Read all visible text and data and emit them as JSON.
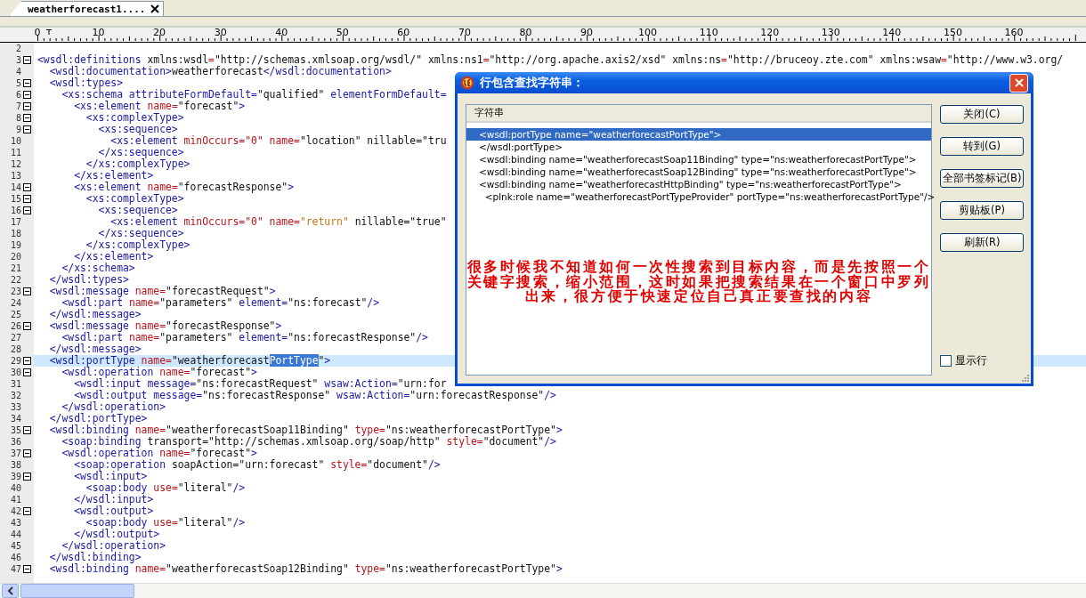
{
  "tabs": [
    {
      "label": "weatherforecast1....",
      "selected": true
    }
  ],
  "ruler": {
    "labels": [
      "0",
      "10",
      "20",
      "30",
      "40",
      "50",
      "60",
      "70",
      "80",
      "90",
      "100",
      "110",
      "120",
      "130",
      "140",
      "150",
      "160"
    ]
  },
  "editor": {
    "lines": [
      {
        "number": "2",
        "fold": false,
        "current": false
      },
      {
        "number": "3",
        "fold": true,
        "current": false,
        "segments": [
          {
            "kind": "tag",
            "text": "<wsdl:definitions "
          },
          {
            "kind": "plain",
            "text": "xmlns:wsdl"
          },
          {
            "kind": "key",
            "text": "="
          },
          {
            "kind": "plain",
            "text": "\"http://schemas.xmlsoap.org/wsdl/\" xmlns:ns1"
          },
          {
            "kind": "key",
            "text": "="
          },
          {
            "kind": "plain",
            "text": "\"http://org.apache.axis2/xsd\" xmlns:ns"
          },
          {
            "kind": "key",
            "text": "="
          },
          {
            "kind": "plain",
            "text": "\"http://bruceoy.zte.com\" xmlns:wsaw"
          },
          {
            "kind": "key",
            "text": "="
          },
          {
            "kind": "plain",
            "text": "\"http://www.w3.org/"
          }
        ]
      },
      {
        "number": "4",
        "fold": false,
        "current": false,
        "segments": [
          {
            "kind": "tag",
            "text": "  <wsdl:documentation>"
          },
          {
            "kind": "plain",
            "text": "weatherforecast"
          },
          {
            "kind": "tag",
            "text": "</wsdl:documentation>"
          }
        ]
      },
      {
        "number": "5",
        "fold": true,
        "current": false,
        "segments": [
          {
            "kind": "tag",
            "text": "  <wsdl:types>"
          }
        ]
      },
      {
        "number": "6",
        "fold": true,
        "current": false,
        "segments": [
          {
            "kind": "tag",
            "text": "    <xs:schema attributeFormDefault="
          },
          {
            "kind": "plain",
            "text": "\"qualified\" "
          },
          {
            "kind": "tag",
            "text": "elementFormDefault="
          }
        ]
      },
      {
        "number": "7",
        "fold": true,
        "current": false,
        "segments": [
          {
            "kind": "tag",
            "text": "      <xs:element "
          },
          {
            "kind": "key",
            "text": "name="
          },
          {
            "kind": "plain",
            "text": "\"forecast\""
          },
          {
            "kind": "tag",
            "text": ">"
          }
        ]
      },
      {
        "number": "8",
        "fold": true,
        "current": false,
        "segments": [
          {
            "kind": "tag",
            "text": "        <xs:complexType>"
          }
        ]
      },
      {
        "number": "9",
        "fold": true,
        "current": false,
        "segments": [
          {
            "kind": "tag",
            "text": "          <xs:sequence>"
          }
        ]
      },
      {
        "number": "10",
        "fold": false,
        "current": false,
        "segments": [
          {
            "kind": "tag",
            "text": "            <xs:element "
          },
          {
            "kind": "key",
            "text": "minOccurs=\"0\" name="
          },
          {
            "kind": "plain",
            "text": "\"location\" nillable=\"tru"
          }
        ]
      },
      {
        "number": "11",
        "fold": false,
        "current": false,
        "segments": [
          {
            "kind": "tag",
            "text": "          </xs:sequence>"
          }
        ]
      },
      {
        "number": "12",
        "fold": false,
        "current": false,
        "segments": [
          {
            "kind": "tag",
            "text": "        </xs:complexType>"
          }
        ]
      },
      {
        "number": "13",
        "fold": false,
        "current": false,
        "segments": [
          {
            "kind": "tag",
            "text": "      </xs:element>"
          }
        ]
      },
      {
        "number": "14",
        "fold": true,
        "current": false,
        "segments": [
          {
            "kind": "tag",
            "text": "      <xs:element "
          },
          {
            "kind": "key",
            "text": "name="
          },
          {
            "kind": "plain",
            "text": "\"forecastResponse\""
          },
          {
            "kind": "tag",
            "text": ">"
          }
        ]
      },
      {
        "number": "15",
        "fold": true,
        "current": false,
        "segments": [
          {
            "kind": "tag",
            "text": "        <xs:complexType>"
          }
        ]
      },
      {
        "number": "16",
        "fold": true,
        "current": false,
        "segments": [
          {
            "kind": "tag",
            "text": "          <xs:sequence>"
          }
        ]
      },
      {
        "number": "17",
        "fold": false,
        "current": false,
        "segments": [
          {
            "kind": "tag",
            "text": "            <xs:element "
          },
          {
            "kind": "key",
            "text": "minOccurs=\"0\" name="
          },
          {
            "kind": "value",
            "text": "\"return\""
          },
          {
            "kind": "plain",
            "text": " nillable=\"true\""
          }
        ]
      },
      {
        "number": "18",
        "fold": false,
        "current": false,
        "segments": [
          {
            "kind": "tag",
            "text": "          </xs:sequence>"
          }
        ]
      },
      {
        "number": "19",
        "fold": false,
        "current": false,
        "segments": [
          {
            "kind": "tag",
            "text": "        </xs:complexType>"
          }
        ]
      },
      {
        "number": "20",
        "fold": false,
        "current": false,
        "segments": [
          {
            "kind": "tag",
            "text": "      </xs:element>"
          }
        ]
      },
      {
        "number": "21",
        "fold": false,
        "current": false,
        "segments": [
          {
            "kind": "tag",
            "text": "    </xs:schema>"
          }
        ]
      },
      {
        "number": "22",
        "fold": false,
        "current": false,
        "segments": [
          {
            "kind": "tag",
            "text": "  </wsdl:types>"
          }
        ]
      },
      {
        "number": "23",
        "fold": true,
        "current": false,
        "segments": [
          {
            "kind": "tag",
            "text": "  <wsdl:message "
          },
          {
            "kind": "key",
            "text": "name="
          },
          {
            "kind": "plain",
            "text": "\"forecastRequest\""
          },
          {
            "kind": "tag",
            "text": ">"
          }
        ]
      },
      {
        "number": "24",
        "fold": false,
        "current": false,
        "segments": [
          {
            "kind": "tag",
            "text": "    <wsdl:part "
          },
          {
            "kind": "key",
            "text": "name="
          },
          {
            "kind": "plain",
            "text": "\"parameters\" "
          },
          {
            "kind": "tag",
            "text": "element="
          },
          {
            "kind": "plain",
            "text": "\"ns:forecast\""
          },
          {
            "kind": "tag",
            "text": "/>"
          }
        ]
      },
      {
        "number": "25",
        "fold": false,
        "current": false,
        "segments": [
          {
            "kind": "tag",
            "text": "  </wsdl:message>"
          }
        ]
      },
      {
        "number": "26",
        "fold": true,
        "current": false,
        "segments": [
          {
            "kind": "tag",
            "text": "  <wsdl:message "
          },
          {
            "kind": "key",
            "text": "name="
          },
          {
            "kind": "plain",
            "text": "\"forecastResponse\""
          },
          {
            "kind": "tag",
            "text": ">"
          }
        ]
      },
      {
        "number": "27",
        "fold": false,
        "current": false,
        "segments": [
          {
            "kind": "tag",
            "text": "    <wsdl:part "
          },
          {
            "kind": "key",
            "text": "name="
          },
          {
            "kind": "plain",
            "text": "\"parameters\" "
          },
          {
            "kind": "tag",
            "text": "element="
          },
          {
            "kind": "plain",
            "text": "\"ns:forecastResponse\""
          },
          {
            "kind": "tag",
            "text": "/>"
          }
        ]
      },
      {
        "number": "28",
        "fold": false,
        "current": false,
        "segments": [
          {
            "kind": "tag",
            "text": "  </wsdl:message>"
          }
        ]
      },
      {
        "number": "29",
        "fold": true,
        "current": true,
        "segments": [
          {
            "kind": "tag",
            "text": "  <wsdl:portType "
          },
          {
            "kind": "key",
            "text": "name="
          },
          {
            "kind": "plain",
            "text": "\"weatherforecast"
          },
          {
            "kind": "selected",
            "text": "PortType"
          },
          {
            "kind": "plain",
            "text": "\""
          },
          {
            "kind": "tag",
            "text": ">"
          }
        ]
      },
      {
        "number": "30",
        "fold": true,
        "current": false,
        "segments": [
          {
            "kind": "tag",
            "text": "    <wsdl:operation "
          },
          {
            "kind": "key",
            "text": "name="
          },
          {
            "kind": "plain",
            "text": "\"forecast\""
          },
          {
            "kind": "tag",
            "text": ">"
          }
        ]
      },
      {
        "number": "31",
        "fold": false,
        "current": false,
        "segments": [
          {
            "kind": "tag",
            "text": "      <wsdl:input message="
          },
          {
            "kind": "plain",
            "text": "\"ns:forecastRequest\" "
          },
          {
            "kind": "tag",
            "text": "wsaw:Action="
          },
          {
            "kind": "plain",
            "text": "\"urn:for"
          }
        ]
      },
      {
        "number": "32",
        "fold": false,
        "current": false,
        "segments": [
          {
            "kind": "tag",
            "text": "      <wsdl:output message="
          },
          {
            "kind": "plain",
            "text": "\"ns:forecastResponse\" "
          },
          {
            "kind": "tag",
            "text": "wsaw:Action="
          },
          {
            "kind": "plain",
            "text": "\"urn:forecastResponse\""
          },
          {
            "kind": "tag",
            "text": "/>"
          }
        ]
      },
      {
        "number": "33",
        "fold": false,
        "current": false,
        "segments": [
          {
            "kind": "tag",
            "text": "    </wsdl:operation>"
          }
        ]
      },
      {
        "number": "34",
        "fold": false,
        "current": false,
        "segments": [
          {
            "kind": "tag",
            "text": "  </wsdl:portType>"
          }
        ]
      },
      {
        "number": "35",
        "fold": true,
        "current": false,
        "segments": [
          {
            "kind": "tag",
            "text": "  <wsdl:binding "
          },
          {
            "kind": "key",
            "text": "name="
          },
          {
            "kind": "plain",
            "text": "\"weatherforecastSoap11Binding\" "
          },
          {
            "kind": "key",
            "text": "type="
          },
          {
            "kind": "plain",
            "text": "\"ns:weatherforecastPortType\""
          },
          {
            "kind": "tag",
            "text": ">"
          }
        ]
      },
      {
        "number": "36",
        "fold": false,
        "current": false,
        "segments": [
          {
            "kind": "tag",
            "text": "    <soap:binding "
          },
          {
            "kind": "plain",
            "text": "transport=\"http://schemas.xmlsoap.org/soap/http\" "
          },
          {
            "kind": "key",
            "text": "style="
          },
          {
            "kind": "plain",
            "text": "\"document\""
          },
          {
            "kind": "tag",
            "text": "/>"
          }
        ]
      },
      {
        "number": "37",
        "fold": true,
        "current": false,
        "segments": [
          {
            "kind": "tag",
            "text": "    <wsdl:operation "
          },
          {
            "kind": "key",
            "text": "name="
          },
          {
            "kind": "plain",
            "text": "\"forecast\""
          },
          {
            "kind": "tag",
            "text": ">"
          }
        ]
      },
      {
        "number": "38",
        "fold": false,
        "current": false,
        "segments": [
          {
            "kind": "tag",
            "text": "      <soap:operation "
          },
          {
            "kind": "plain",
            "text": "soapAction=\"urn:forecast\" "
          },
          {
            "kind": "key",
            "text": "style="
          },
          {
            "kind": "plain",
            "text": "\"document\""
          },
          {
            "kind": "tag",
            "text": "/>"
          }
        ]
      },
      {
        "number": "39",
        "fold": true,
        "current": false,
        "segments": [
          {
            "kind": "tag",
            "text": "      <wsdl:input>"
          }
        ]
      },
      {
        "number": "40",
        "fold": false,
        "current": false,
        "segments": [
          {
            "kind": "tag",
            "text": "        <soap:body "
          },
          {
            "kind": "key",
            "text": "use="
          },
          {
            "kind": "plain",
            "text": "\"literal\""
          },
          {
            "kind": "tag",
            "text": "/>"
          }
        ]
      },
      {
        "number": "41",
        "fold": false,
        "current": false,
        "segments": [
          {
            "kind": "tag",
            "text": "      </wsdl:input>"
          }
        ]
      },
      {
        "number": "42",
        "fold": true,
        "current": false,
        "segments": [
          {
            "kind": "tag",
            "text": "      <wsdl:output>"
          }
        ]
      },
      {
        "number": "43",
        "fold": false,
        "current": false,
        "segments": [
          {
            "kind": "tag",
            "text": "        <soap:body "
          },
          {
            "kind": "key",
            "text": "use="
          },
          {
            "kind": "plain",
            "text": "\"literal\""
          },
          {
            "kind": "tag",
            "text": "/>"
          }
        ]
      },
      {
        "number": "44",
        "fold": false,
        "current": false,
        "segments": [
          {
            "kind": "tag",
            "text": "      </wsdl:output>"
          }
        ]
      },
      {
        "number": "45",
        "fold": false,
        "current": false,
        "segments": [
          {
            "kind": "tag",
            "text": "    </wsdl:operation>"
          }
        ]
      },
      {
        "number": "46",
        "fold": false,
        "current": false,
        "segments": [
          {
            "kind": "tag",
            "text": "  </wsdl:binding>"
          }
        ]
      },
      {
        "number": "47",
        "fold": true,
        "current": false,
        "segments": [
          {
            "kind": "tag",
            "text": "  <wsdl:binding "
          },
          {
            "kind": "key",
            "text": "name="
          },
          {
            "kind": "plain",
            "text": "\"weatherforecastSoap12Binding\" "
          },
          {
            "kind": "key",
            "text": "type="
          },
          {
            "kind": "plain",
            "text": "\"ns:weatherforecastPortType\""
          },
          {
            "kind": "tag",
            "text": ">"
          }
        ]
      }
    ]
  },
  "dialog": {
    "title": "行包含查找字符串：",
    "list": {
      "header": "字符串",
      "rows": [
        {
          "text": "<wsdl:portType name=\"weatherforecastPortType\">",
          "selected": true
        },
        {
          "text": "</wsdl:portType>",
          "selected": false
        },
        {
          "text": "<wsdl:binding name=\"weatherforecastSoap11Binding\" type=\"ns:weatherforecastPortType\">",
          "selected": false
        },
        {
          "text": "<wsdl:binding name=\"weatherforecastSoap12Binding\" type=\"ns:weatherforecastPortType\">",
          "selected": false
        },
        {
          "text": "<wsdl:binding name=\"weatherforecastHttpBinding\" type=\"ns:weatherforecastPortType\">",
          "selected": false
        },
        {
          "text": "  <plnk:role name=\"weatherforecastPortTypeProvider\" portType=\"ns:weatherforecastPortType\"/>",
          "selected": false
        }
      ]
    },
    "annotation": [
      "很多时候我不知道如何一次性搜索到目标内容，而是先按照一个",
      "关键字搜索，缩小范围，这时如果把搜索结果在一个窗口中罗列",
      "出来，很方便于快速定位自己真正要查找的内容"
    ],
    "buttons": [
      "关闭(C)",
      "转到(G)",
      "全部书签标记(B)",
      "剪贴板(P)",
      "刷新(R)"
    ],
    "checkbox": {
      "label": "显示行",
      "checked": false
    }
  }
}
